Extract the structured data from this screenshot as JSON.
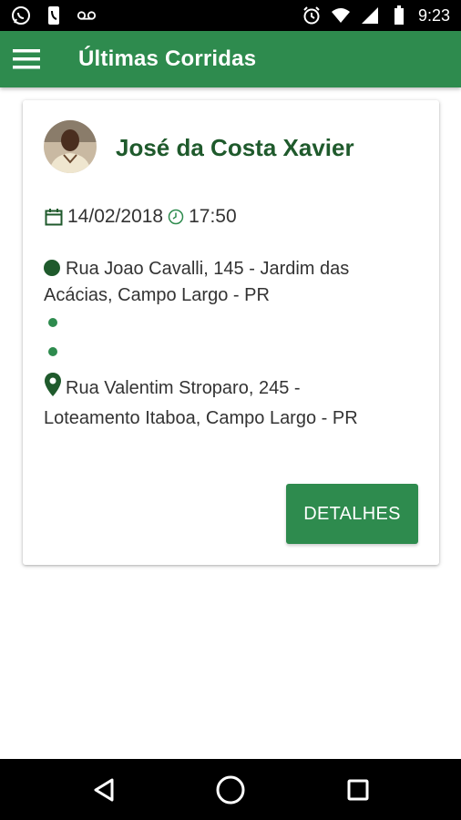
{
  "status_bar": {
    "time": "9:23",
    "icons": [
      "whatsapp-icon",
      "phone-icon",
      "voicemail-icon",
      "alarm-icon",
      "wifi-icon",
      "signal-icon",
      "battery-icon"
    ]
  },
  "app_bar": {
    "title": "Últimas Corridas",
    "color": "#2e8b4e"
  },
  "ride_card": {
    "driver_name": "José da Costa Xavier",
    "date": "14/02/2018",
    "time": "17:50",
    "origin": "Rua Joao Cavalli, 145 - Jardim das Acácias, Campo Largo - PR",
    "destination": "Rua Valentim Stroparo, 245 - Loteamento Itaboa, Campo Largo - PR",
    "details_label": "DETALHES"
  },
  "colors": {
    "primary": "#2e8b4e",
    "dark_green": "#1f5a2c"
  },
  "nav_bar": {
    "icons": [
      "back-icon",
      "home-icon",
      "recents-icon"
    ]
  }
}
